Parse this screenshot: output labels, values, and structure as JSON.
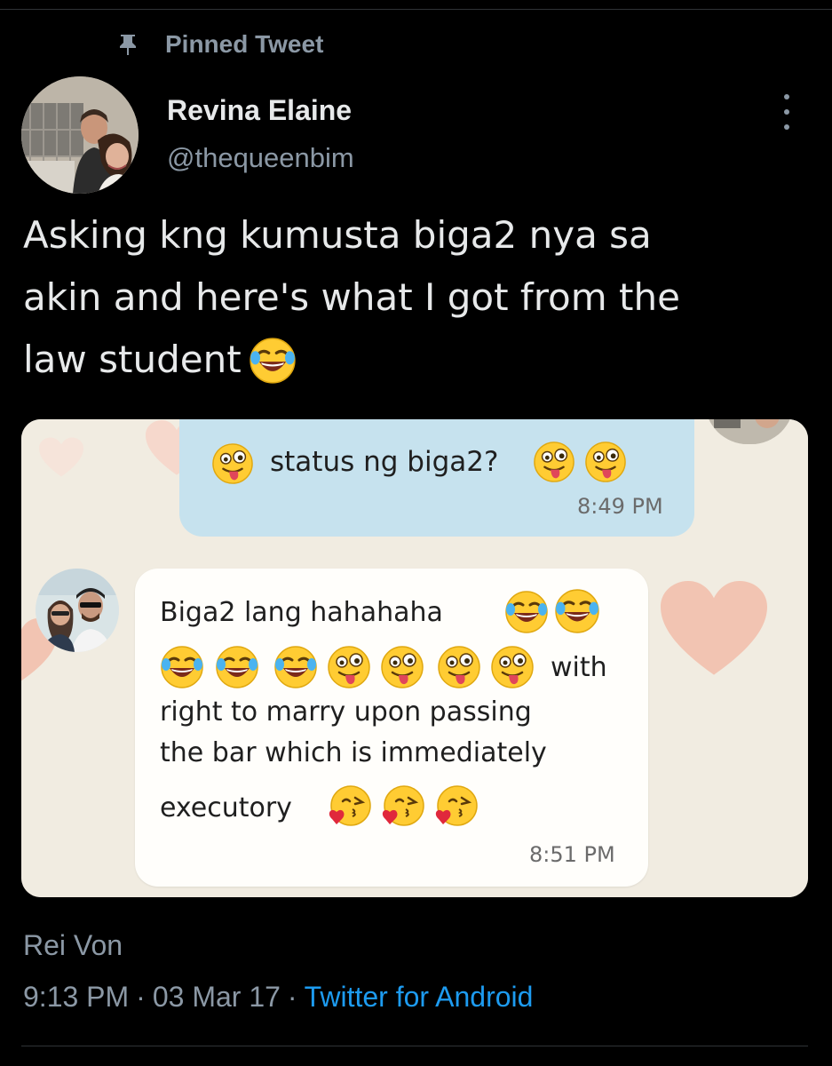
{
  "pinned": {
    "icon": "pin-icon",
    "label": "Pinned Tweet"
  },
  "author": {
    "name": "Revina Elaine",
    "handle": "@thequeenbim",
    "avatar_icon": "avatar"
  },
  "more_icon": "more-vertical-icon",
  "tweet": {
    "text_line1": "Asking kng kumusta biga2 nya sa",
    "text_line2": "akin and here's what I got from the",
    "text_line3": "law student",
    "emoji": "face-with-tears-of-joy-icon"
  },
  "chat": {
    "outgoing": {
      "text": "status ng biga2?",
      "time": "8:49 PM"
    },
    "incoming": {
      "line1": "Biga2 lang hahahaha",
      "line2_tail": "with",
      "line3": "right to marry upon passing",
      "line4": "the bar which is immediately",
      "line5": "executory",
      "time": "8:51 PM"
    }
  },
  "footer": {
    "image_credit": "Rei Von",
    "time": "9:13 PM",
    "separator": "·",
    "date": "03 Mar 17",
    "source": "Twitter for Android"
  },
  "colors": {
    "background": "#000000",
    "text_primary": "#e7e9ea",
    "text_secondary": "#8b98a5",
    "link": "#1d9bf0",
    "bubble_out": "#c6e2ee",
    "bubble_in": "#fffefb"
  }
}
